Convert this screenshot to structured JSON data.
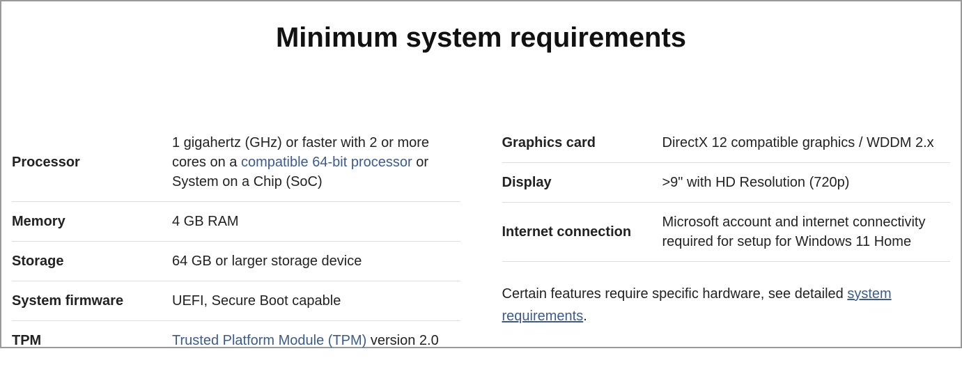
{
  "title": "Minimum system requirements",
  "left": {
    "processor": {
      "label": "Processor",
      "value_before": "1 gigahertz (GHz) or faster with 2 or more cores on a ",
      "link": "compatible 64-bit processor",
      "value_after": " or System on a Chip (SoC)"
    },
    "memory": {
      "label": "Memory",
      "value": "4 GB RAM"
    },
    "storage": {
      "label": "Storage",
      "value": "64 GB or larger storage device"
    },
    "firmware": {
      "label": "System firmware",
      "value": "UEFI, Secure Boot capable"
    },
    "tpm": {
      "label": "TPM",
      "link": "Trusted Platform Module (TPM)",
      "value_after": " version 2.0"
    }
  },
  "right": {
    "graphics": {
      "label": "Graphics card",
      "value": "DirectX 12 compatible graphics / WDDM 2.x"
    },
    "display": {
      "label": "Display",
      "value": ">9\" with HD Resolution (720p)"
    },
    "internet": {
      "label": "Internet connection",
      "value": "Microsoft account and internet connectivity required for setup for Windows 11 Home"
    }
  },
  "footnote": {
    "before": "Certain features require specific hardware, see detailed ",
    "link": "system requirements",
    "after": "."
  }
}
